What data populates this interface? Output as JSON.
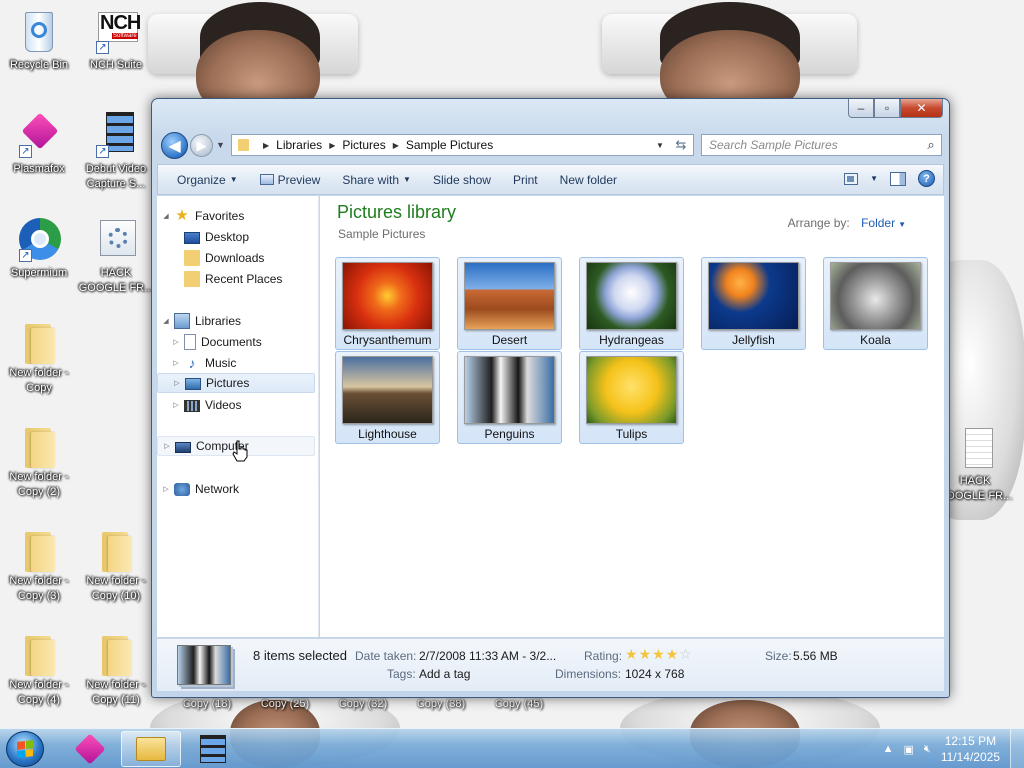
{
  "desktop": {
    "icons": [
      {
        "label": "Recycle Bin",
        "icon": "recycle-bin-icon"
      },
      {
        "label": "NCH Suite",
        "icon": "nch-suite-icon",
        "badge": "NCH",
        "badge_sub": "Software"
      },
      {
        "label": "Plasmafox",
        "icon": "plasmafox-icon"
      },
      {
        "label": "Debut Video Capture S...",
        "icon": "debut-video-icon"
      },
      {
        "label": "Supermium",
        "icon": "supermium-icon"
      },
      {
        "label": "HACK GOOGLE FR...",
        "icon": "hack-google-icon"
      },
      {
        "label": "New folder - Copy",
        "icon": "folder-icon"
      },
      {
        "label": "New folder - Copy (2)",
        "icon": "folder-icon"
      },
      {
        "label": "New folder - Copy (3)",
        "icon": "folder-icon"
      },
      {
        "label": "New folder - Copy (10)",
        "icon": "folder-icon"
      },
      {
        "label": "New folder - Copy (4)",
        "icon": "folder-icon"
      },
      {
        "label": "New folder - Copy (11)",
        "icon": "folder-icon"
      },
      {
        "label": "HACK GOOGLE FR...",
        "icon": "text-file-icon"
      }
    ],
    "partial_labels": [
      "Copy (18)",
      "Copy (25)",
      "Copy (32)",
      "Copy (38)",
      "Copy (45)"
    ]
  },
  "window": {
    "address": {
      "crumbs": [
        "Libraries",
        "Pictures",
        "Sample Pictures"
      ]
    },
    "search_placeholder": "Search Sample Pictures",
    "toolbar": {
      "organize": "Organize",
      "preview": "Preview",
      "share_with": "Share with",
      "slide_show": "Slide show",
      "print": "Print",
      "new_folder": "New folder"
    },
    "nav": {
      "favorites": "Favorites",
      "desktop": "Desktop",
      "downloads": "Downloads",
      "recent_places": "Recent Places",
      "libraries": "Libraries",
      "documents": "Documents",
      "music": "Music",
      "pictures": "Pictures",
      "videos": "Videos",
      "computer": "Computer",
      "network": "Network"
    },
    "content": {
      "title": "Pictures library",
      "subtitle": "Sample Pictures",
      "arrange_label": "Arrange by:",
      "arrange_value": "Folder",
      "files": [
        {
          "name": "Chrysanthemum"
        },
        {
          "name": "Desert"
        },
        {
          "name": "Hydrangeas"
        },
        {
          "name": "Jellyfish"
        },
        {
          "name": "Koala"
        },
        {
          "name": "Lighthouse"
        },
        {
          "name": "Penguins"
        },
        {
          "name": "Tulips"
        }
      ]
    },
    "details": {
      "count": "8 items selected",
      "date_label": "Date taken:",
      "date_value": "2/7/2008 11:33 AM - 3/2...",
      "tags_label": "Tags:",
      "tags_value": "Add a tag",
      "rating_label": "Rating:",
      "rating_value": 4,
      "rating_max": 5,
      "dimensions_label": "Dimensions:",
      "dimensions_value": "1024 x 768",
      "size_label": "Size:",
      "size_value": "5.56 MB"
    }
  },
  "taskbar": {
    "time": "12:15 PM",
    "date": "11/14/2025"
  },
  "colors": {
    "library_title": "#1e7d1e",
    "link_blue": "#1e5ab4",
    "selection_fill": "#d4e5f8",
    "selection_border": "#9fc1e6"
  }
}
